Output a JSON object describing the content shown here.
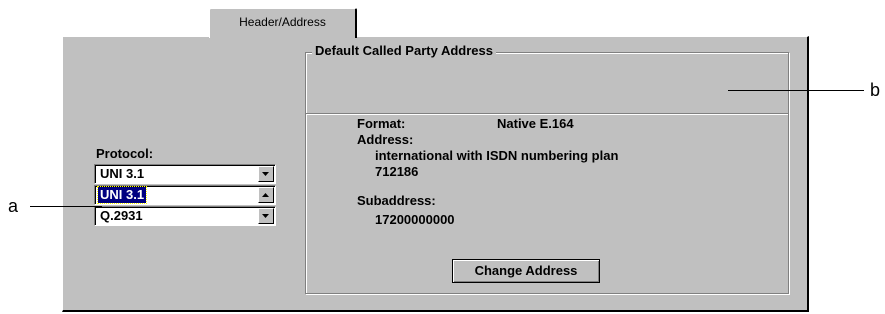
{
  "tab": {
    "label": "Header/Address"
  },
  "protocol": {
    "label": "Protocol:",
    "selected_value": "UNI 3.1",
    "options": [
      "UNI 3.1",
      "Q.2931"
    ]
  },
  "group": {
    "title": "Default Called Party Address",
    "format_label": "Format:",
    "format_value": "Native E.164",
    "address_label": "Address:",
    "address_line1": "international with ISDN numbering plan",
    "address_line2": "712186",
    "subaddress_label": "Subaddress:",
    "subaddress_value": "17200000000",
    "change_button": "Change Address"
  },
  "callouts": {
    "a": "a",
    "b": "b"
  }
}
